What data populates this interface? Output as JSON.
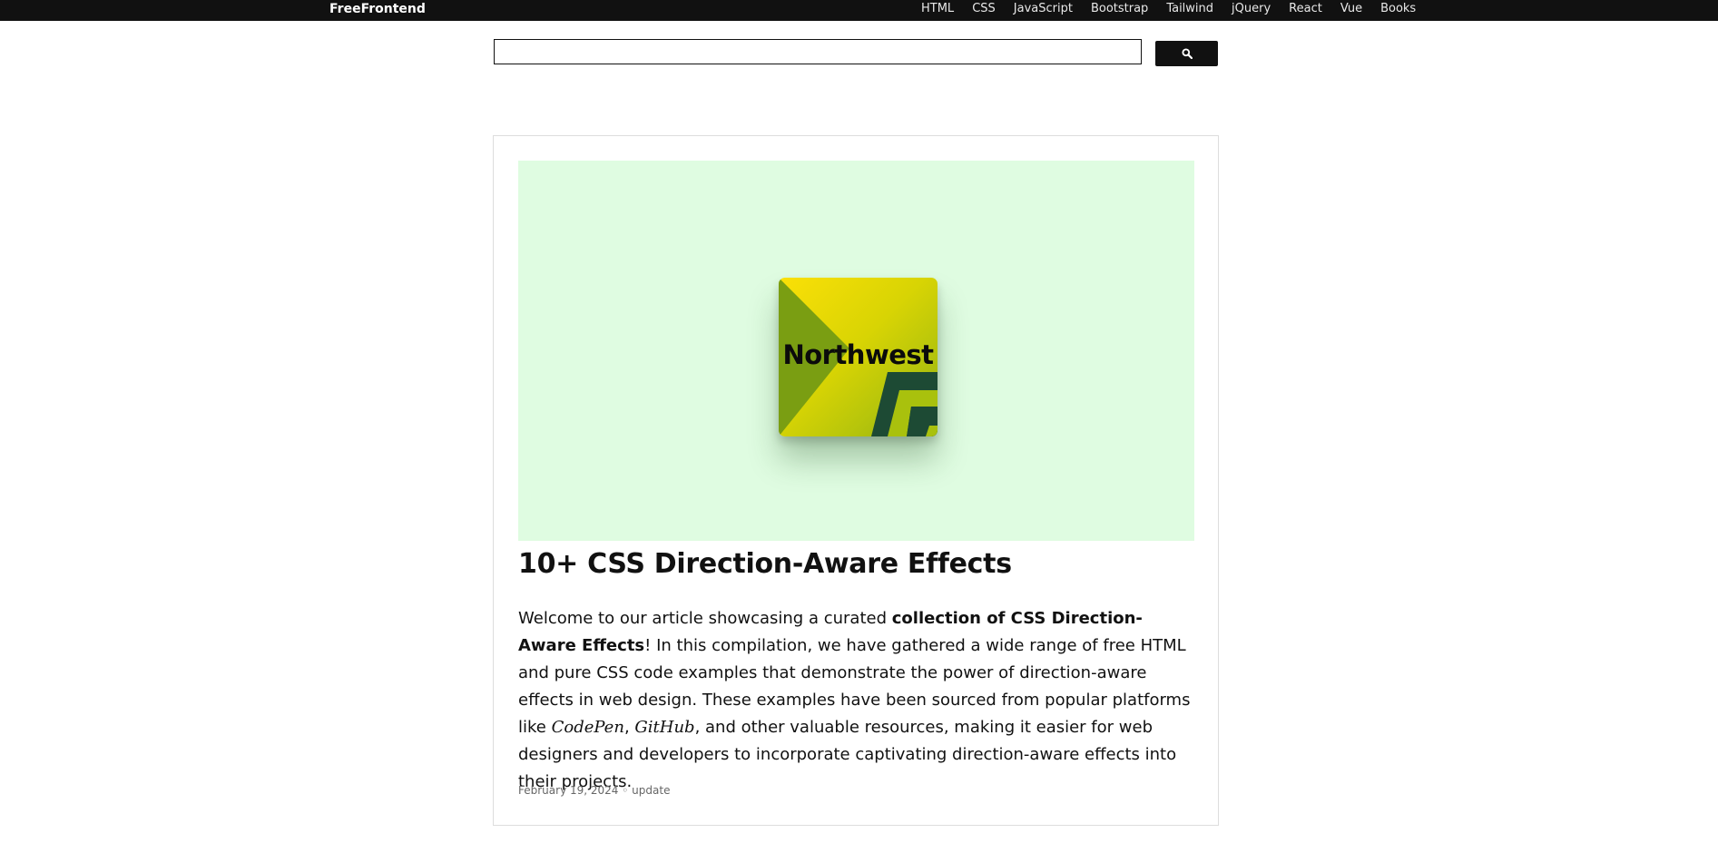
{
  "header": {
    "brand": "FreeFrontend",
    "nav": [
      "HTML",
      "CSS",
      "JavaScript",
      "Bootstrap",
      "Tailwind",
      "jQuery",
      "React",
      "Vue",
      "Books"
    ]
  },
  "search": {
    "value": "",
    "button_icon": "search-icon"
  },
  "article": {
    "hero_tile_label": "Northwest",
    "title": "10+ CSS Direction-Aware Effects",
    "description": {
      "intro": "Welcome to our article showcasing a curated ",
      "bold": "collection of CSS Direction-Aware Effects",
      "middle": "! In this compilation, we have gathered a wide range of free HTML and pure CSS code examples that demonstrate the power of direction-aware effects in web design. These examples have been sourced from popular platforms like ",
      "platform_1": "CodePen",
      "separator": ", ",
      "platform_2": "GitHub",
      "outro": ", and other valuable resources, making it easier for web designers and developers to incorporate captivating direction-aware effects into their projects."
    },
    "date": "February 19, 2024",
    "meta_separator": "◦",
    "tag": "update"
  },
  "colors": {
    "topbar": "#111111",
    "hero_background": "#dffce1",
    "tile_yellow": "#fbe007",
    "tile_dark_green": "#1d4a34",
    "tile_olive": "#7a9e12"
  }
}
